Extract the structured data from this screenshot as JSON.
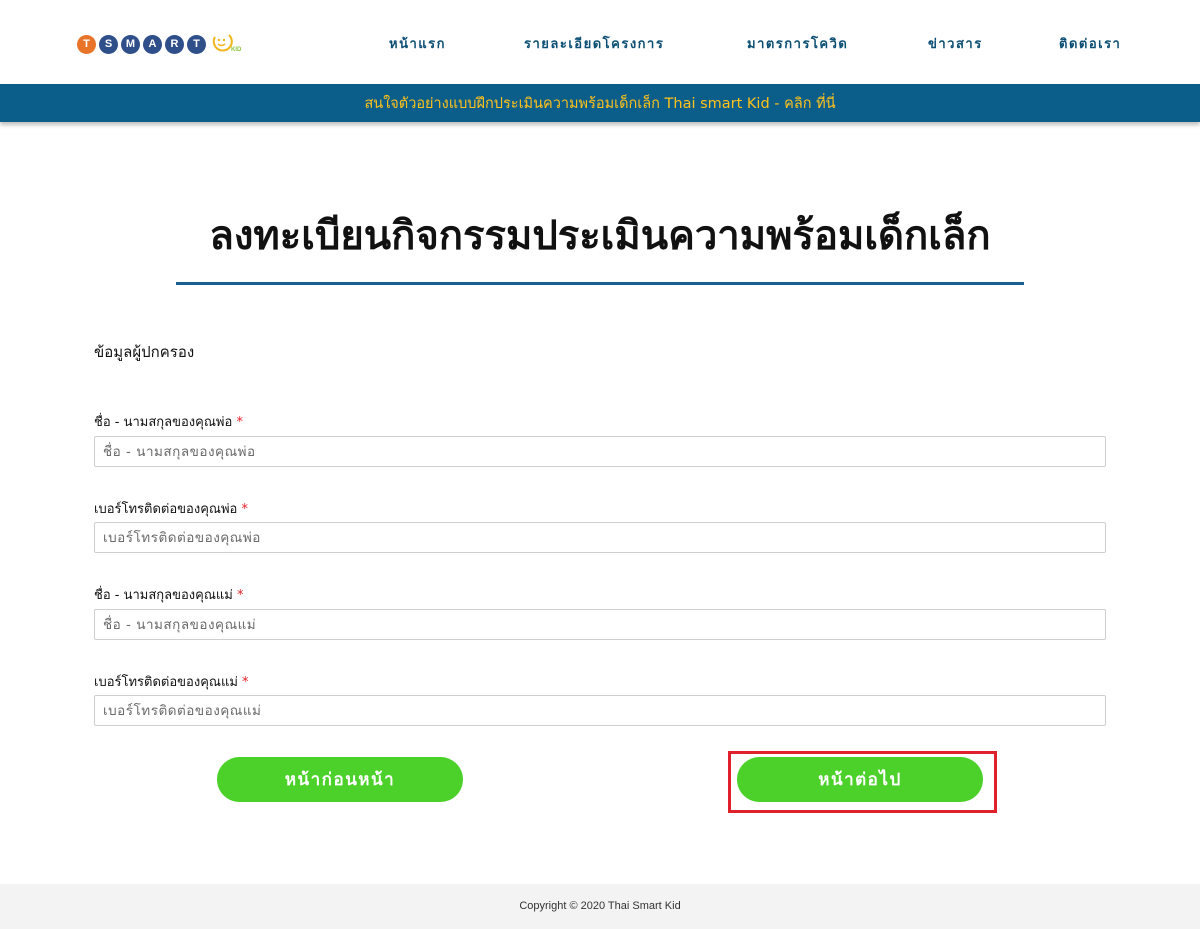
{
  "logo": {
    "letters": [
      "T",
      "S",
      "M",
      "A",
      "R",
      "T"
    ],
    "letter_colors": [
      "#e8742a",
      "#2f4f8a",
      "#2f4f8a",
      "#2f4f8a",
      "#2f4f8a",
      "#2f4f8a"
    ],
    "kid_text": "KID"
  },
  "nav": {
    "items": [
      "หน้าแรก",
      "รายละเอียดโครงการ",
      "มาตรการโควิด",
      "ข่าวสาร",
      "ติดต่อเรา"
    ]
  },
  "announcement": {
    "text": "สนใจตัวอย่างแบบฝึกประเมินความพร้อมเด็กเล็ก Thai smart Kid - คลิก ที่นี่"
  },
  "page": {
    "title": "ลงทะเบียนกิจกรรมประเมินความพร้อมเด็กเล็ก",
    "section_label": "ข้อมูลผู้ปกครอง"
  },
  "form": {
    "fields": [
      {
        "label": "ชื่อ - นามสกุลของคุณพ่อ",
        "required": "*",
        "placeholder": "ชื่อ - นามสกุลของคุณพ่อ",
        "value": ""
      },
      {
        "label": "เบอร์โทรติดต่อของคุณพ่อ",
        "required": "*",
        "placeholder": "เบอร์โทรติดต่อของคุณพ่อ",
        "value": ""
      },
      {
        "label": "ชื่อ - นามสกุลของคุณแม่",
        "required": "*",
        "placeholder": "ชื่อ - นามสกุลของคุณแม่",
        "value": ""
      },
      {
        "label": "เบอร์โทรติดต่อของคุณแม่",
        "required": "*",
        "placeholder": "เบอร์โทรติดต่อของคุณแม่",
        "value": ""
      }
    ],
    "prev_label": "หน้าก่อนหน้า",
    "next_label": "หน้าต่อไป"
  },
  "colors": {
    "nav_text": "#0d4f74",
    "announcement_bg": "#0b5e8a",
    "announcement_text": "#ffc21a",
    "button_green": "#4cd12a",
    "highlight_red": "#e0202a",
    "title_rule": "#1a5f94"
  },
  "footer": {
    "copyright": "Copyright © 2020 Thai Smart Kid"
  }
}
